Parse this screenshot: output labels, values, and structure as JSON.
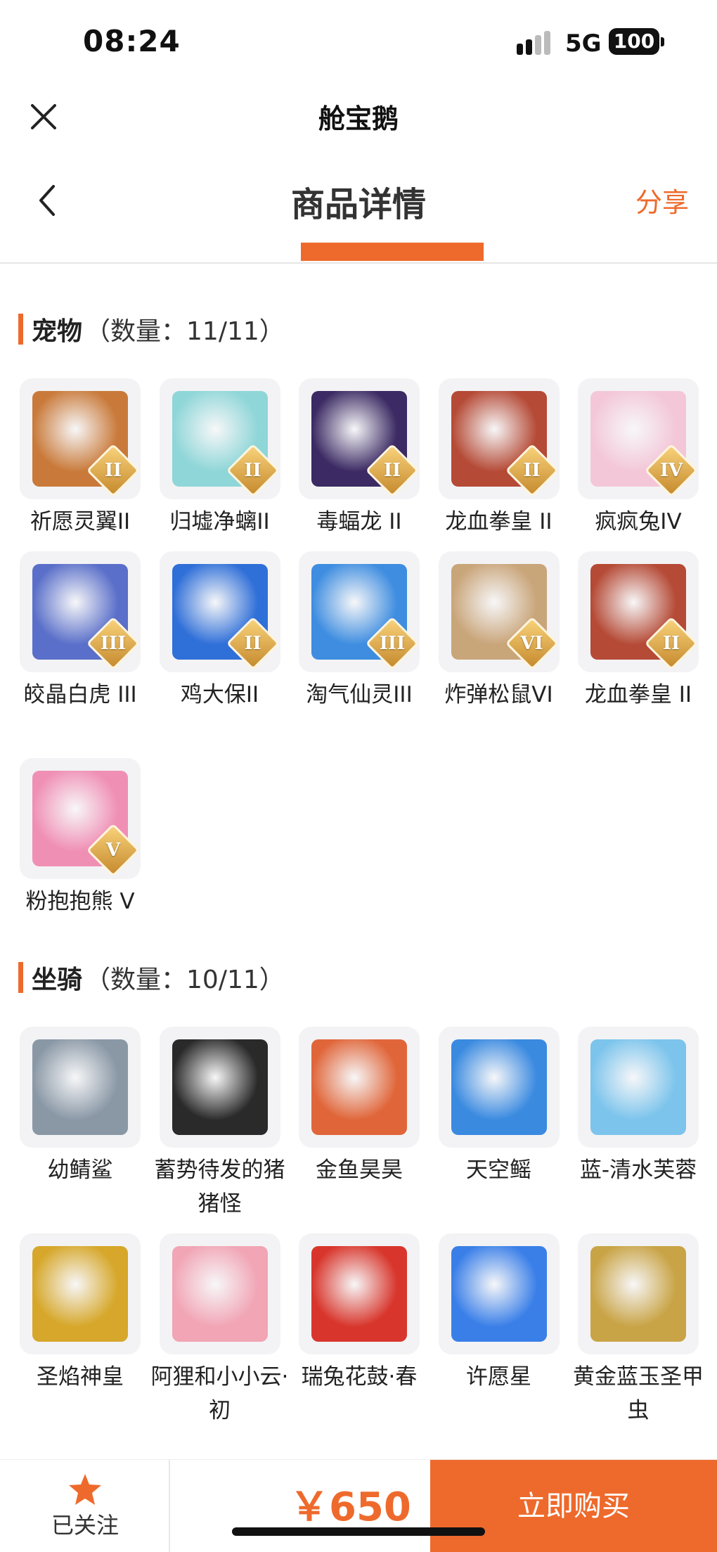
{
  "status_bar": {
    "time": "08:24",
    "network": "5G",
    "battery": "100"
  },
  "mini_header": {
    "title": "舱宝鹅"
  },
  "page_nav": {
    "title": "商品详情",
    "share": "分享"
  },
  "pets": {
    "name": "宠物",
    "count": "（数量：11/11）",
    "items": [
      {
        "label": "祈愿灵翼II",
        "badge": "II",
        "icon": "griffin-pet-icon",
        "color": "#c97a3a"
      },
      {
        "label": "归墟净螭II",
        "badge": "II",
        "icon": "water-dragon-pet-icon",
        "color": "#8fd6d8"
      },
      {
        "label": "毒蝠龙 II",
        "badge": "II",
        "icon": "bat-dragon-pet-icon",
        "color": "#3b2a63"
      },
      {
        "label": "龙血拳皇 II",
        "badge": "II",
        "icon": "ram-demon-pet-icon",
        "color": "#b54a36"
      },
      {
        "label": "疯疯兔IV",
        "badge": "IV",
        "icon": "rabbit-pet-icon",
        "color": "#f3c7d8"
      },
      {
        "label": "皎晶白虎 III",
        "badge": "III",
        "icon": "white-tiger-pet-icon",
        "color": "#5a6fc9"
      },
      {
        "label": "鸡大保II",
        "badge": "II",
        "icon": "blue-bird-pet-icon",
        "color": "#2f6fd8"
      },
      {
        "label": "淘气仙灵III",
        "badge": "III",
        "icon": "blue-puppy-pet-icon",
        "color": "#3e8de0"
      },
      {
        "label": "炸弹松鼠VI",
        "badge": "VI",
        "icon": "squirrel-pet-icon",
        "color": "#c9a57a"
      },
      {
        "label": "龙血拳皇 II",
        "badge": "II",
        "icon": "ram-demon-pet-icon",
        "color": "#b54a36"
      },
      {
        "label": "粉抱抱熊 V",
        "badge": "V",
        "icon": "pink-bear-pet-icon",
        "color": "#f08fb4"
      }
    ]
  },
  "mounts": {
    "name": "坐骑",
    "count": "（数量：10/11）",
    "items": [
      {
        "label": "幼鲭鲨",
        "icon": "shark-mount-icon",
        "color": "#8a98a6"
      },
      {
        "label": "蓄势待发的猪猪怪",
        "icon": "pig-mount-icon",
        "color": "#2a2a2a"
      },
      {
        "label": "金鱼昊昊",
        "icon": "goldfish-mount-icon",
        "color": "#e0663a"
      },
      {
        "label": "天空鳐",
        "icon": "sky-ray-mount-icon",
        "color": "#3a8ae0"
      },
      {
        "label": "蓝-清水芙蓉",
        "icon": "lotus-mount-icon",
        "color": "#7cc4ec"
      },
      {
        "label": "圣焰神皇",
        "icon": "golden-dragon-mount-icon",
        "color": "#d6a72a"
      },
      {
        "label": "阿狸和小小云·初",
        "icon": "fox-cloud-mount-icon",
        "color": "#f1a5b5"
      },
      {
        "label": "瑞兔花鼓·春",
        "icon": "drum-mount-icon",
        "color": "#d8362c"
      },
      {
        "label": "许愿星",
        "icon": "star-mount-icon",
        "color": "#3a7fe8"
      },
      {
        "label": "黄金蓝玉圣甲虫",
        "icon": "scarab-mount-icon",
        "color": "#c9a446"
      }
    ]
  },
  "bottom_bar": {
    "follow": "已关注",
    "price": "￥650",
    "buy": "立即购买"
  },
  "colors": {
    "accent": "#ee6a2c",
    "card_bg": "#f3f3f5"
  }
}
